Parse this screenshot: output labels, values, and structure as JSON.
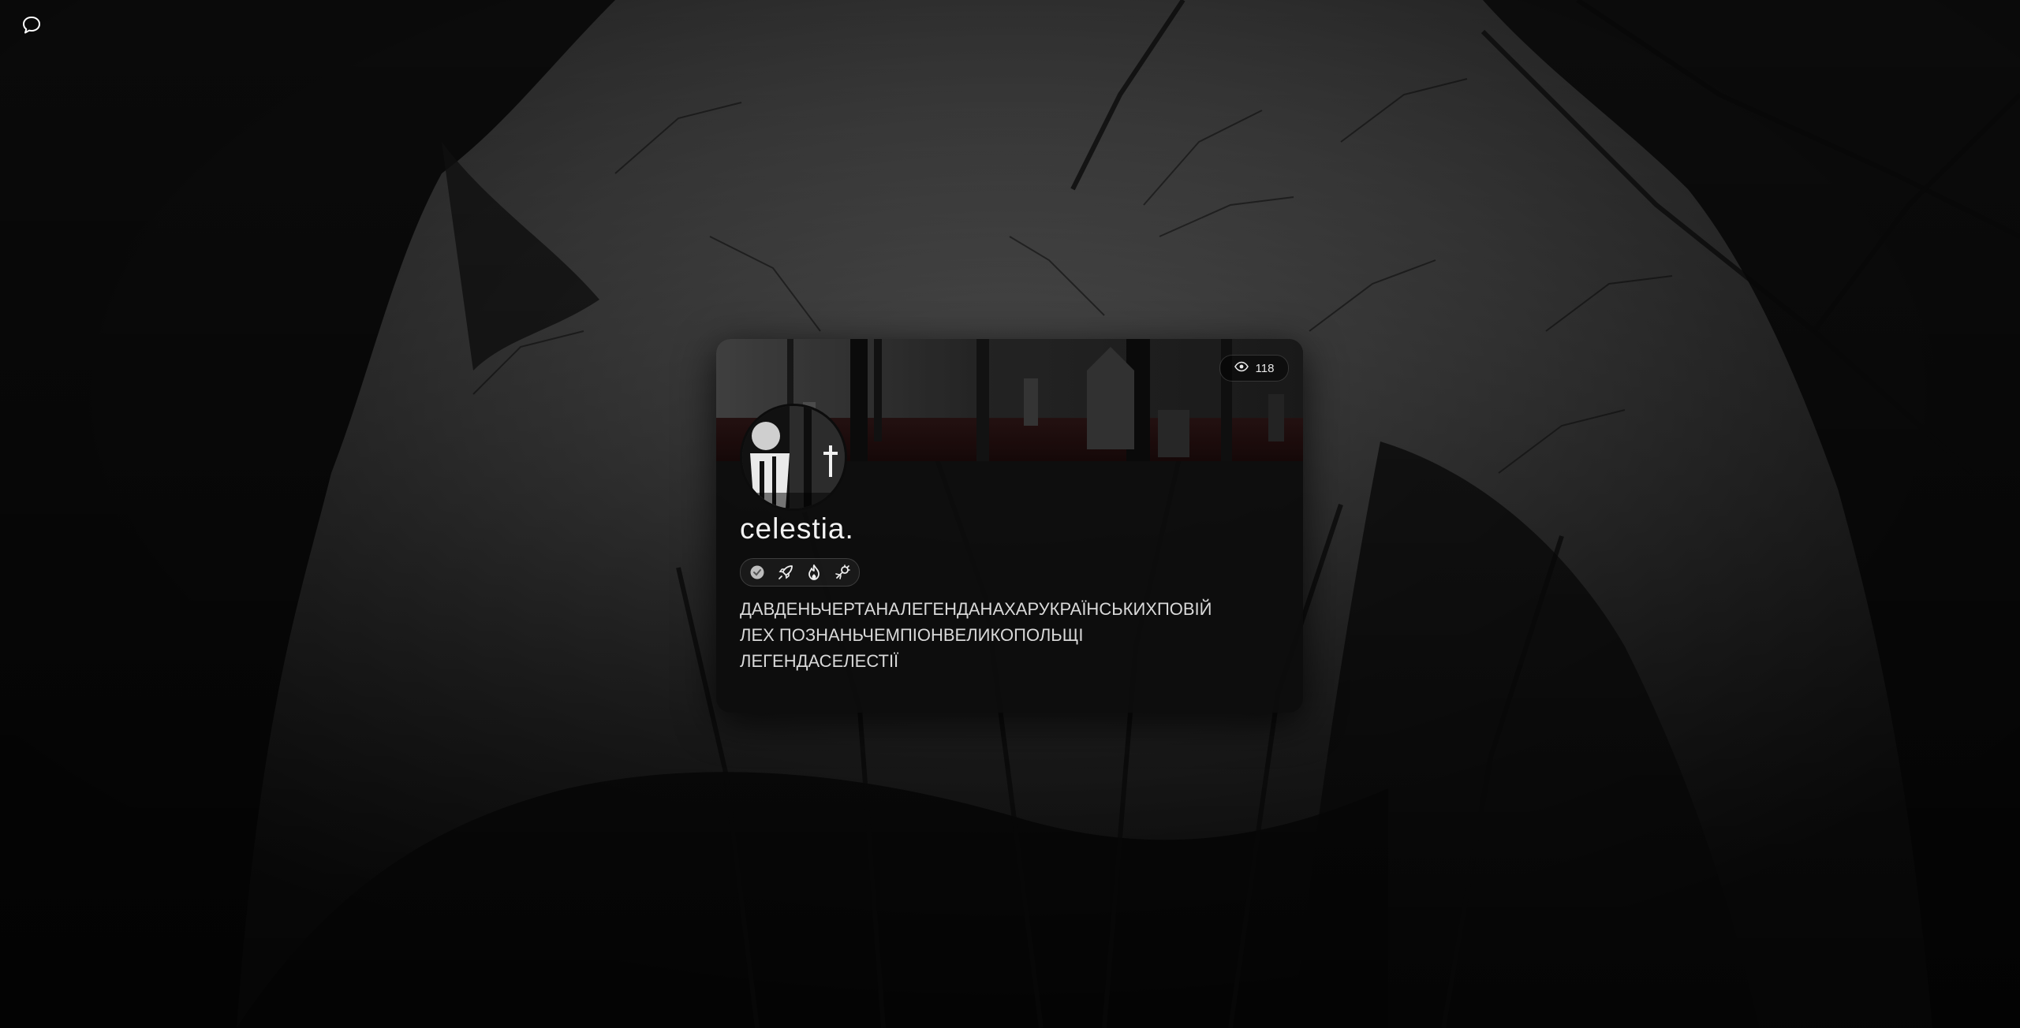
{
  "profile": {
    "username": "celestia.",
    "views": "118",
    "bio_lines": [
      "ДАВДЕНЬЧЕРТАНАЛЕГЕНДАНАХАРУКРАЇНСЬКИХПОВІЙ",
      "ЛЕХ ПОЗНАНЬЧЕМПІОНВЕЛИКОПОЛЬЩІ",
      "ЛЕГЕНДАСЕЛЕСТІЇ"
    ],
    "badges": [
      "verified-badge-icon",
      "rocket-icon",
      "flame-icon",
      "bug-hunter-icon"
    ]
  },
  "icons": {
    "chat": "speech-bubble-icon",
    "views": "eye-icon"
  },
  "colors": {
    "card_bg": "#0c0c0c",
    "text_primary": "#f2f2f2",
    "text_secondary": "#d9d9d9"
  }
}
